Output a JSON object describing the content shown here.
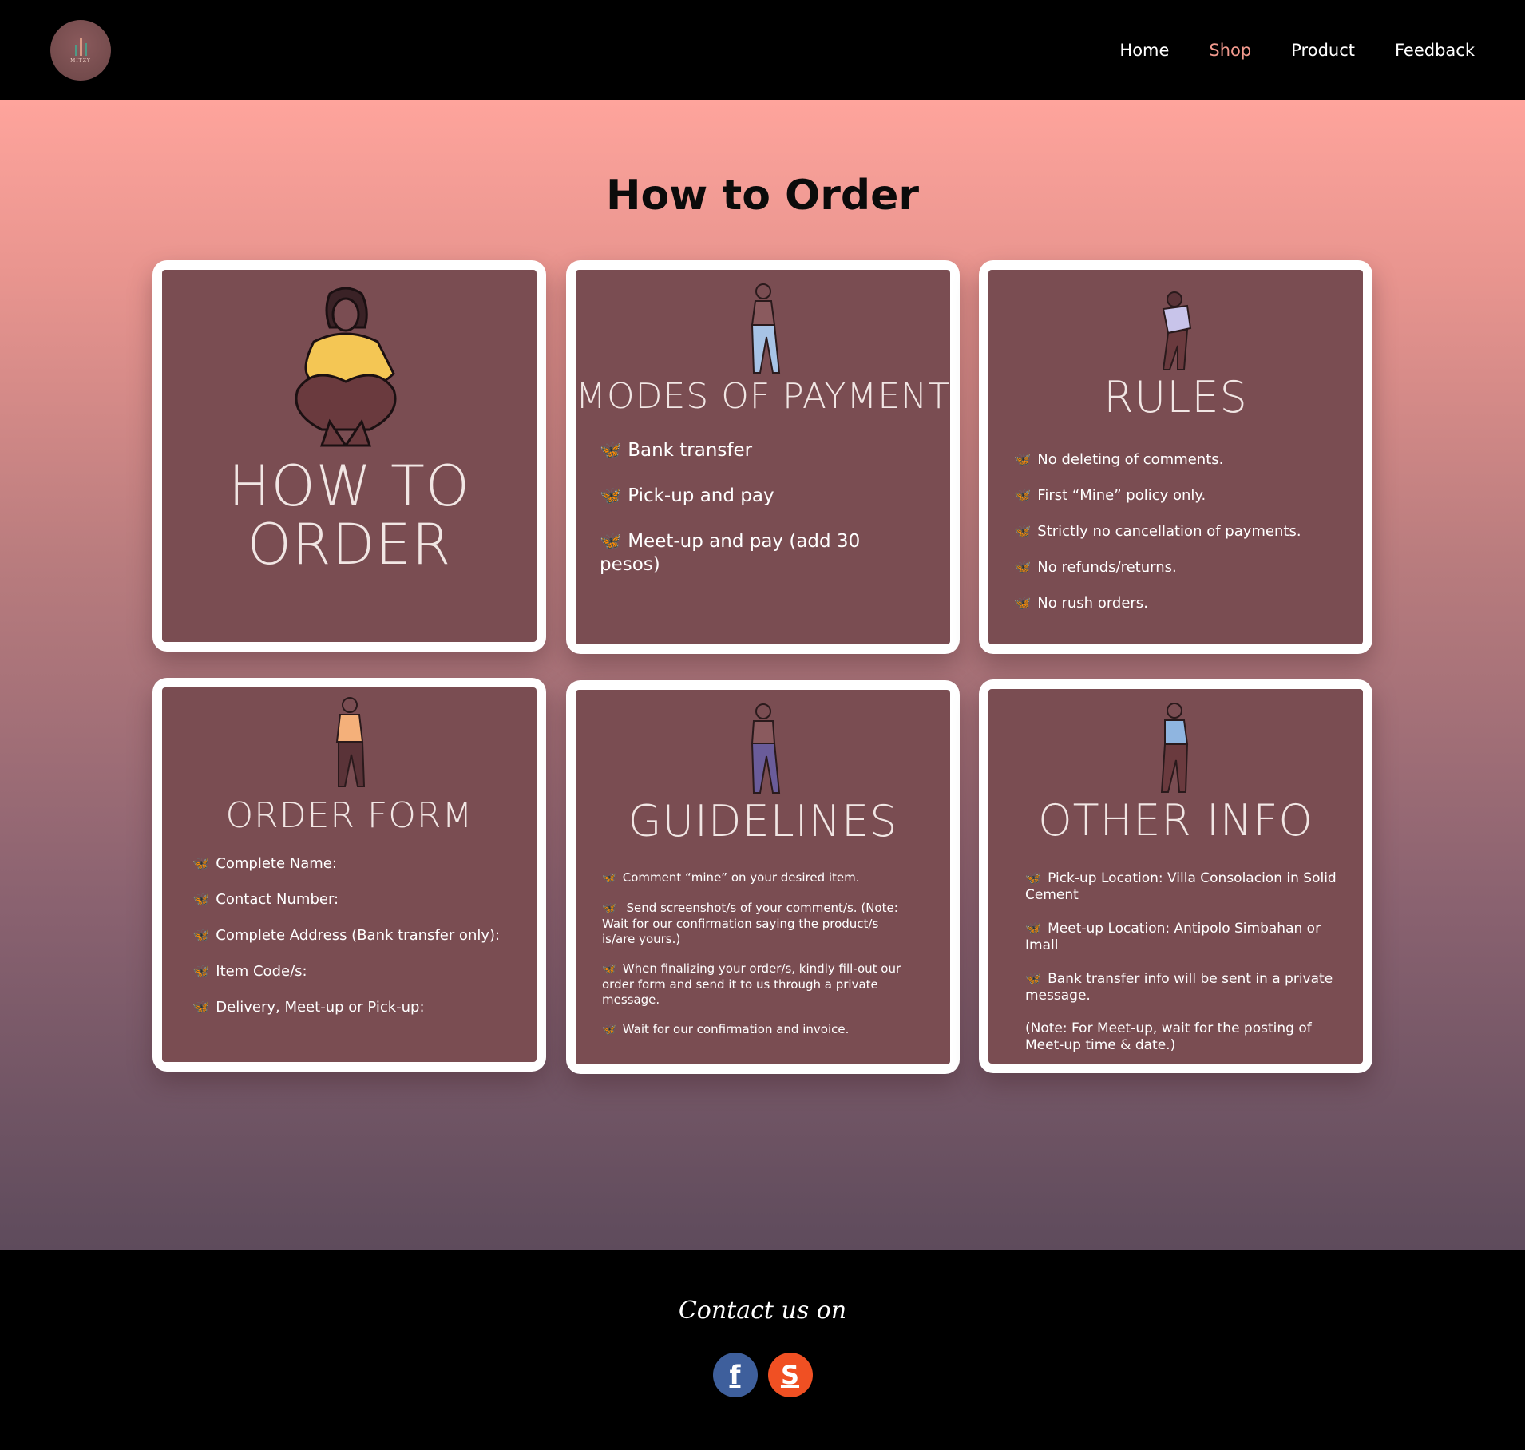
{
  "nav": {
    "logo_text": "MITZY",
    "links": [
      {
        "label": "Home"
      },
      {
        "label": "Shop"
      },
      {
        "label": "Product"
      },
      {
        "label": "Feedback"
      }
    ],
    "active": "Shop"
  },
  "page": {
    "title": "How to Order"
  },
  "cards": {
    "how_to_order": {
      "title_line1": "HOW TO",
      "title_line2": "ORDER"
    },
    "modes_of_payment": {
      "title": "MODES OF PAYMENT",
      "items": [
        "Bank transfer",
        "Pick-up and pay",
        "Meet-up and pay (add 30 pesos)"
      ]
    },
    "rules": {
      "title": "RULES",
      "items": [
        "No deleting of comments.",
        "First “Mine” policy only.",
        "Strictly no cancellation of payments.",
        "No refunds/returns.",
        "No rush orders."
      ]
    },
    "order_form": {
      "title": "ORDER FORM",
      "items": [
        "Complete Name:",
        "Contact Number:",
        "Complete Address (Bank transfer only):",
        "Item Code/s:",
        "Delivery, Meet-up or Pick-up:"
      ]
    },
    "guidelines": {
      "title": "GUIDELINES",
      "items": [
        "Comment “mine” on your desired item.",
        " Send screenshot/s of your comment/s. (Note: Wait for our confirmation saying the product/s is/are yours.)",
        "When finalizing your order/s, kindly fill-out our order form and send it to us through a private message.",
        "Wait for our confirmation and invoice."
      ]
    },
    "other_info": {
      "title": "OTHER INFO",
      "items": [
        "Pick-up Location: Villa Consolacion in Solid Cement",
        "Meet-up Location: Antipolo Simbahan or Imall",
        "Bank transfer info will be sent in a private message."
      ],
      "note": "(Note: For Meet-up, wait for the posting of Meet-up time & date.)"
    }
  },
  "footer": {
    "contact_label": "Contact us on",
    "socials": [
      {
        "name": "Facebook",
        "glyph": "f"
      },
      {
        "name": "Shopee",
        "glyph": "S"
      }
    ]
  },
  "icons": {
    "bullet": "butterfly-icon"
  },
  "colors": {
    "active_link": "#f29a8e",
    "card_bg": "#7a4d52",
    "bullet": "#3fb3f0",
    "facebook": "#3e5f9c",
    "shopee": "#f05023"
  }
}
